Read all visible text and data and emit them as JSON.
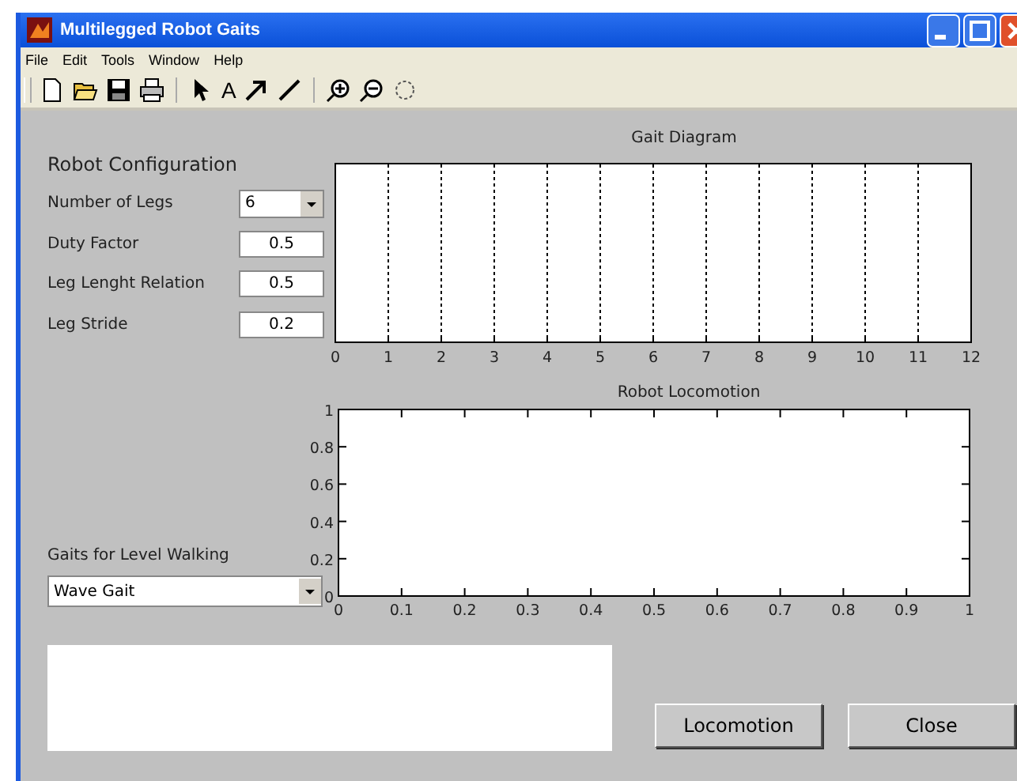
{
  "window": {
    "title": "Multilegged Robot Gaits"
  },
  "menu": [
    "File",
    "Edit",
    "Tools",
    "Window",
    "Help"
  ],
  "toolbar": [
    {
      "kind": "new"
    },
    {
      "kind": "open"
    },
    {
      "kind": "save"
    },
    {
      "kind": "print"
    },
    {
      "kind": "separator"
    },
    {
      "kind": "pointer"
    },
    {
      "kind": "text",
      "label": "A"
    },
    {
      "kind": "arrow"
    },
    {
      "kind": "line"
    },
    {
      "kind": "separator"
    },
    {
      "kind": "zoom-in"
    },
    {
      "kind": "zoom-out"
    },
    {
      "kind": "rotate"
    }
  ],
  "configuration": {
    "title": "Robot Configuration",
    "fields": [
      {
        "label": "Number of Legs",
        "kind": "dropdown",
        "value": "6"
      },
      {
        "label": "Duty Factor",
        "kind": "input",
        "value": "0.5"
      },
      {
        "label": "Leg Lenght Relation",
        "kind": "input",
        "value": "0.5"
      },
      {
        "label": "Leg Stride",
        "kind": "input",
        "value": "0.2"
      }
    ]
  },
  "gaits": {
    "label": "Gaits for Level Walking",
    "value": "Wave Gait"
  },
  "gait_diagram": {
    "title": "Gait Diagram",
    "x_tick_labels": [
      "0",
      "1",
      "2",
      "3",
      "4",
      "5",
      "6",
      "7",
      "8",
      "9",
      "10",
      "11",
      "12"
    ]
  },
  "robot_locomotion": {
    "chart_data": {
      "type": "line",
      "title": "Robot Locomotion",
      "xlim": [
        0,
        1
      ],
      "ylim": [
        0,
        1
      ],
      "xticks": [
        0,
        0.1,
        0.2,
        0.3,
        0.4,
        0.5,
        0.6,
        0.7,
        0.8,
        0.9,
        1
      ],
      "yticks": [
        0,
        0.2,
        0.4,
        0.6,
        0.8,
        1
      ]
    }
  },
  "buttons": [
    "Locomotion",
    "Close"
  ]
}
